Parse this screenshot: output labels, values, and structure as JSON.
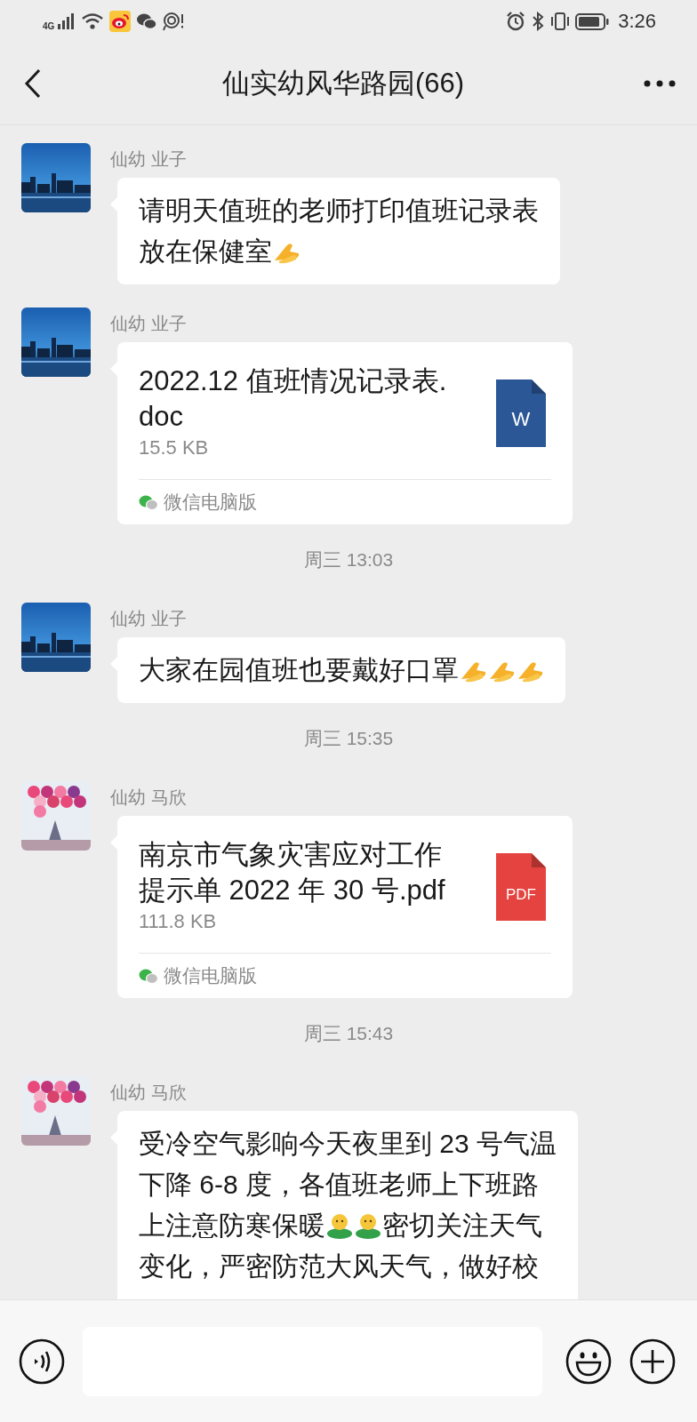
{
  "status_bar": {
    "network": "4G",
    "time": "3:26"
  },
  "header": {
    "title": "仙实幼风华路园(66)"
  },
  "chat": [
    {
      "kind": "text",
      "sender": "仙幼 业子",
      "lines": [
        [
          {
            "kind": "text",
            "text": "请明天值班的老师打印值班记录表"
          }
        ],
        [
          {
            "kind": "text",
            "text": "放在保健室"
          },
          {
            "kind": "pray"
          }
        ]
      ]
    },
    {
      "kind": "file",
      "sender": "仙幼 业子",
      "file_name": "2022.12 值班情况记录表.doc",
      "size": "15.5 KB",
      "color": "#2b5797",
      "icon_label": "W",
      "source": "微信电脑版"
    },
    {
      "kind": "time",
      "text": "周三 13:03"
    },
    {
      "kind": "text",
      "sender": "仙幼 业子",
      "lines": [
        [
          {
            "kind": "text",
            "text": "大家在园值班也要戴好口罩"
          },
          {
            "kind": "pray"
          },
          {
            "kind": "pray"
          },
          {
            "kind": "pray"
          }
        ]
      ]
    },
    {
      "kind": "time",
      "text": "周三 15:35"
    },
    {
      "kind": "file",
      "sender": "仙幼 马欣",
      "file_name": "南京市气象灾害应对工作提示单 2022 年 30 号.pdf",
      "size": "111.8 KB",
      "color": "#e5433f",
      "icon_label": "PDF",
      "source": "微信电脑版"
    },
    {
      "kind": "time",
      "text": "周三 15:43"
    },
    {
      "kind": "text",
      "sender": "仙幼 马欣",
      "lines": [
        [
          {
            "kind": "text",
            "text": "受冷空气影响今天夜里到 23 号气温"
          }
        ],
        [
          {
            "kind": "text",
            "text": "下降 6-8 度，各值班老师上下班路"
          }
        ],
        [
          {
            "kind": "text",
            "text": "上注意防寒保暖"
          },
          {
            "kind": "hug"
          },
          {
            "kind": "hug"
          },
          {
            "kind": "text",
            "text": "密切关注天气"
          }
        ],
        [
          {
            "kind": "text",
            "text": "变化，严密防范大风天气，做好校"
          }
        ]
      ]
    }
  ]
}
